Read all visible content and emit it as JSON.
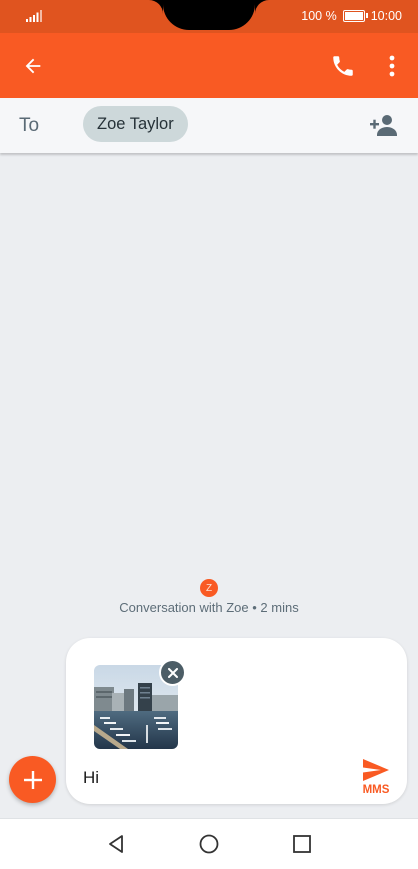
{
  "status_bar": {
    "battery_text": "100 %",
    "time": "10:00"
  },
  "app_bar": {
    "back_icon": "arrow-back-icon",
    "call_icon": "phone-icon",
    "more_icon": "more-vert-icon",
    "color": "#f95a23"
  },
  "recipients": {
    "to_label": "To",
    "chip_name": "Zoe Taylor",
    "add_icon": "add-contact-icon"
  },
  "conversation": {
    "avatar_letter": "Z",
    "info": "Conversation with Zoe • 2 mins"
  },
  "compose": {
    "attachment_icon": "photo-thumbnail",
    "message": "Hi",
    "send_label": "MMS"
  },
  "nav": {
    "back": "nav-back-icon",
    "home": "nav-home-icon",
    "recents": "nav-recents-icon"
  }
}
